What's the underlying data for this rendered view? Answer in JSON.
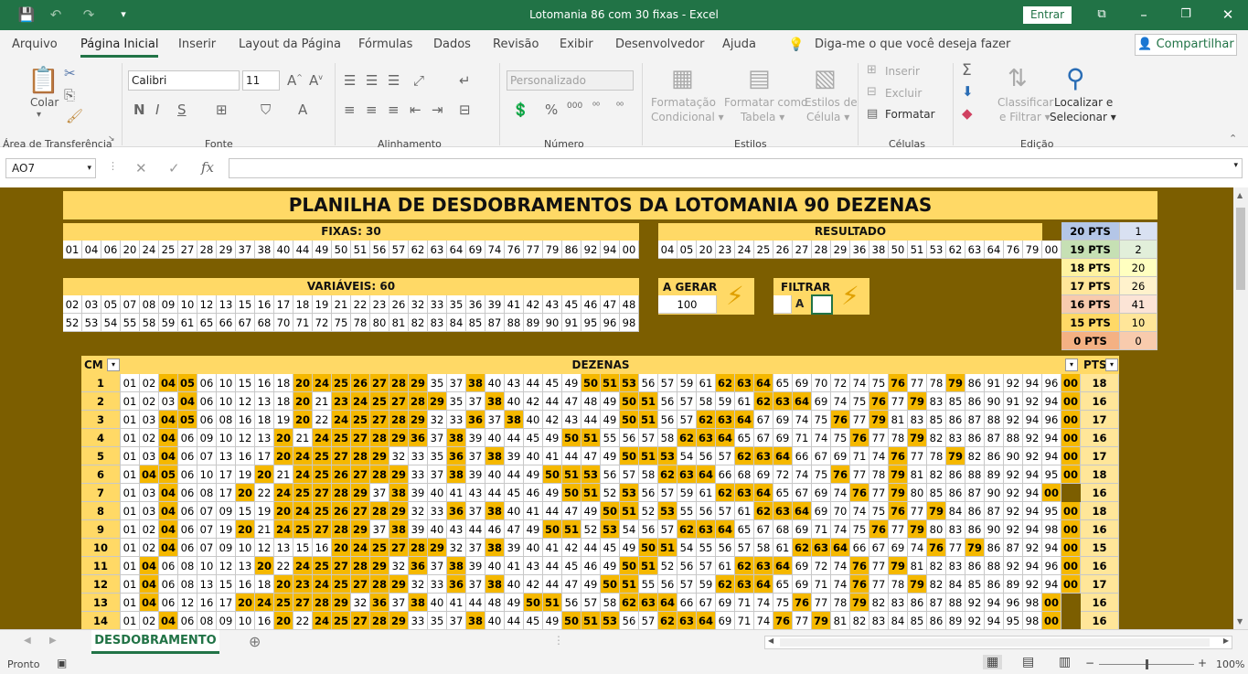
{
  "window": {
    "title": "Lotomania 86 com 30 fixas  -  Excel",
    "signin_label": "Entrar"
  },
  "menu": [
    "Arquivo",
    "Página Inicial",
    "Inserir",
    "Layout da Página",
    "Fórmulas",
    "Dados",
    "Revisão",
    "Exibir",
    "Desenvolvedor",
    "Ajuda"
  ],
  "tell_me": "Diga-me o que você deseja fazer",
  "share_label": "Compartilhar",
  "ribbon": {
    "paste": "Colar",
    "clipboard": "Área de Transferência",
    "font_name": "Calibri",
    "font_size": "11",
    "font_group": "Fonte",
    "align_group": "Alinhamento",
    "number_format": "Personalizado",
    "number_group": "Número",
    "cond_format_1": "Formatação",
    "cond_format_2": "Condicional ▾",
    "format_table_1": "Formatar como",
    "format_table_2": "Tabela ▾",
    "cell_styles_1": "Estilos de",
    "cell_styles_2": "Célula ▾",
    "styles_group": "Estilos",
    "insert": "Inserir",
    "delete": "Excluir",
    "format": "Formatar",
    "cells_group": "Células",
    "sort_1": "Classificar",
    "sort_2": "e Filtrar ▾",
    "find_1": "Localizar e",
    "find_2": "Selecionar ▾",
    "edit_group": "Edição"
  },
  "name_box": "AO7",
  "sheet": {
    "title": "PLANILHA DE DESDOBRAMENTOS DA LOTOMANIA 90 DEZENAS",
    "fixas_label": "FIXAS: 30",
    "fixas": [
      "01",
      "04",
      "06",
      "20",
      "24",
      "25",
      "27",
      "28",
      "29",
      "37",
      "38",
      "40",
      "44",
      "49",
      "50",
      "51",
      "56",
      "57",
      "62",
      "63",
      "64",
      "69",
      "74",
      "76",
      "77",
      "79",
      "86",
      "92",
      "94",
      "00"
    ],
    "resultado_label": "RESULTADO",
    "resultado": [
      "04",
      "05",
      "20",
      "23",
      "24",
      "25",
      "26",
      "27",
      "28",
      "29",
      "36",
      "38",
      "50",
      "51",
      "53",
      "62",
      "63",
      "64",
      "76",
      "79",
      "00"
    ],
    "variaveis_label": "VARIÁVEIS: 60",
    "variaveis_row1": [
      "02",
      "03",
      "05",
      "07",
      "08",
      "09",
      "10",
      "12",
      "13",
      "15",
      "16",
      "17",
      "18",
      "19",
      "21",
      "22",
      "23",
      "26",
      "32",
      "33",
      "35",
      "36",
      "39",
      "41",
      "42",
      "43",
      "45",
      "46",
      "47",
      "48"
    ],
    "variaveis_row2": [
      "52",
      "53",
      "54",
      "55",
      "58",
      "59",
      "61",
      "65",
      "66",
      "67",
      "68",
      "70",
      "71",
      "72",
      "75",
      "78",
      "80",
      "81",
      "82",
      "83",
      "84",
      "85",
      "87",
      "88",
      "89",
      "90",
      "91",
      "95",
      "96",
      "98"
    ],
    "gerar_label": "A GERAR",
    "gerar_value": "100",
    "filtrar_label": "FILTRAR",
    "filtrar_a": "A",
    "pts_summary": [
      {
        "label": "20 PTS",
        "count": "1",
        "color": "#b4c6e7",
        "color2": "#d9e1f2"
      },
      {
        "label": "19 PTS",
        "count": "2",
        "color": "#c6e0b4",
        "color2": "#e2efda"
      },
      {
        "label": "18 PTS",
        "count": "20",
        "color": "#fff2a0",
        "color2": "#ffffc0"
      },
      {
        "label": "17 PTS",
        "count": "26",
        "color": "#ffe699",
        "color2": "#fff2cc"
      },
      {
        "label": "16 PTS",
        "count": "41",
        "color": "#f8cbad",
        "color2": "#fce4d6"
      },
      {
        "label": "15 PTS",
        "count": "10",
        "color": "#ffd966",
        "color2": "#ffe699"
      },
      {
        "label": "0 PTS",
        "count": "0",
        "color": "#f4b183",
        "color2": "#f8cbad"
      }
    ],
    "col_cm": "CM",
    "col_dezenas": "DEZENAS",
    "col_pts": "PTS",
    "rows": [
      {
        "cm": "1",
        "nums": "01 02 04 05 06 10 15 16 18 20 24 25 26 27 28 29 35 37 38 40 43 44 45 49 50 51 53 56 57 59 61 62 63 64 65 69 70 72 74 75 76 77 78 79 86 91 92 94 96 00",
        "pts": "18"
      },
      {
        "cm": "2",
        "nums": "01 02 03 04 06 10 12 13 18 20 21 23 24 25 27 28 29 35 37 38 40 42 44 47 48 49 50 51 56 57 58 59 61 62 63 64 69 74 75 76 77 79 83 85 86 90 91 92 94 00",
        "pts": "16"
      },
      {
        "cm": "3",
        "nums": "01 03 04 05 06 08 16 18 19 20 22 24 25 27 28 29 32 33 36 37 38 40 42 43 44 49 50 51 56 57 62 63 64 67 69 74 75 76 77 79 81 83 85 86 87 88 92 94 96 00",
        "pts": "17"
      },
      {
        "cm": "4",
        "nums": "01 02 04 06 09 10 12 13 20 21 24 25 27 28 29 36 37 38 39 40 44 45 49 50 51 55 56 57 58 62 63 64 65 67 69 71 74 75 76 77 78 79 82 83 86 87 88 92 94 00",
        "pts": "16"
      },
      {
        "cm": "5",
        "nums": "01 03 04 06 07 13 16 17 20 24 25 27 28 29 32 33 35 36 37 38 39 40 41 44 47 49 50 51 53 54 56 57 62 63 64 66 67 69 71 74 76 77 78 79 82 86 90 92 94 00",
        "pts": "17"
      },
      {
        "cm": "6",
        "nums": "01 04 05 06 10 17 19 20 21 24 25 26 27 28 29 33 37 38 39 40 44 49 50 51 53 56 57 58 62 63 64 66 68 69 72 74 75 76 77 78 79 81 82 86 88 89 92 94 95 00",
        "pts": "18"
      },
      {
        "cm": "7",
        "nums": "01 03 04 06 08 17 20 22 24 25 27 28 29 37 38 39 40 41 43 44 45 46 49 50 51 52 53 56 57 59 61 62 63 64 65 67 69 74 76 77 79 80 85 86 87 90 92 94 00",
        "pts": "16"
      },
      {
        "cm": "8",
        "nums": "01 03 04 06 07 09 15 19 20 24 25 26 27 28 29 32 33 36 37 38 40 41 44 47 49 50 51 52 53 55 56 57 61 62 63 64 69 70 74 75 76 77 79 84 86 87 92 94 95 00",
        "pts": "18"
      },
      {
        "cm": "9",
        "nums": "01 02 04 06 07 19 20 21 24 25 27 28 29 37 38 39 40 43 44 46 47 49 50 51 52 53 54 56 57 62 63 64 65 67 68 69 71 74 75 76 77 79 80 83 86 90 92 94 98 00",
        "pts": "16"
      },
      {
        "cm": "10",
        "nums": "01 02 04 06 07 09 10 12 13 15 16 20 24 25 27 28 29 32 37 38 39 40 41 42 44 45 49 50 51 54 55 56 57 58 61 62 63 64 66 67 69 74 76 77 79 86 87 92 94 00",
        "pts": "15"
      },
      {
        "cm": "11",
        "nums": "01 04 06 08 10 12 13 20 22 24 25 27 28 29 32 36 37 38 39 40 41 43 44 45 46 49 50 51 52 56 57 61 62 63 64 69 72 74 76 77 79 81 82 83 86 88 92 94 96 00",
        "pts": "16"
      },
      {
        "cm": "12",
        "nums": "01 04 06 08 13 15 16 18 20 23 24 25 27 28 29 32 33 36 37 38 40 42 44 47 49 50 51 55 56 57 59 62 63 64 65 69 71 74 76 77 78 79 82 84 85 86 89 92 94 00",
        "pts": "17"
      },
      {
        "cm": "13",
        "nums": "01 04 06 12 16 17 20 24 25 27 28 29 32 36 37 38 40 41 44 48 49 50 51 56 57 58 62 63 64 66 67 69 71 74 75 76 77 78 79 82 83 86 87 88 92 94 96 98 00",
        "pts": "16"
      },
      {
        "cm": "14",
        "nums": "01 02 04 06 08 09 10 16 20 22 24 25 27 28 29 33 35 37 38 40 44 45 49 50 51 53 56 57 62 63 64 69 71 74 76 77 79 81 82 83 84 85 86 89 92 94 95 98 00",
        "pts": "16"
      }
    ]
  },
  "sheet_tab": "DESDOBRAMENTO",
  "status": {
    "ready": "Pronto",
    "zoom": "100%"
  },
  "colors": {
    "excel_green": "#217346",
    "sheet_bg": "#7c5e00",
    "header_yellow": "#ffd966",
    "hit_orange": "#f5b800"
  }
}
